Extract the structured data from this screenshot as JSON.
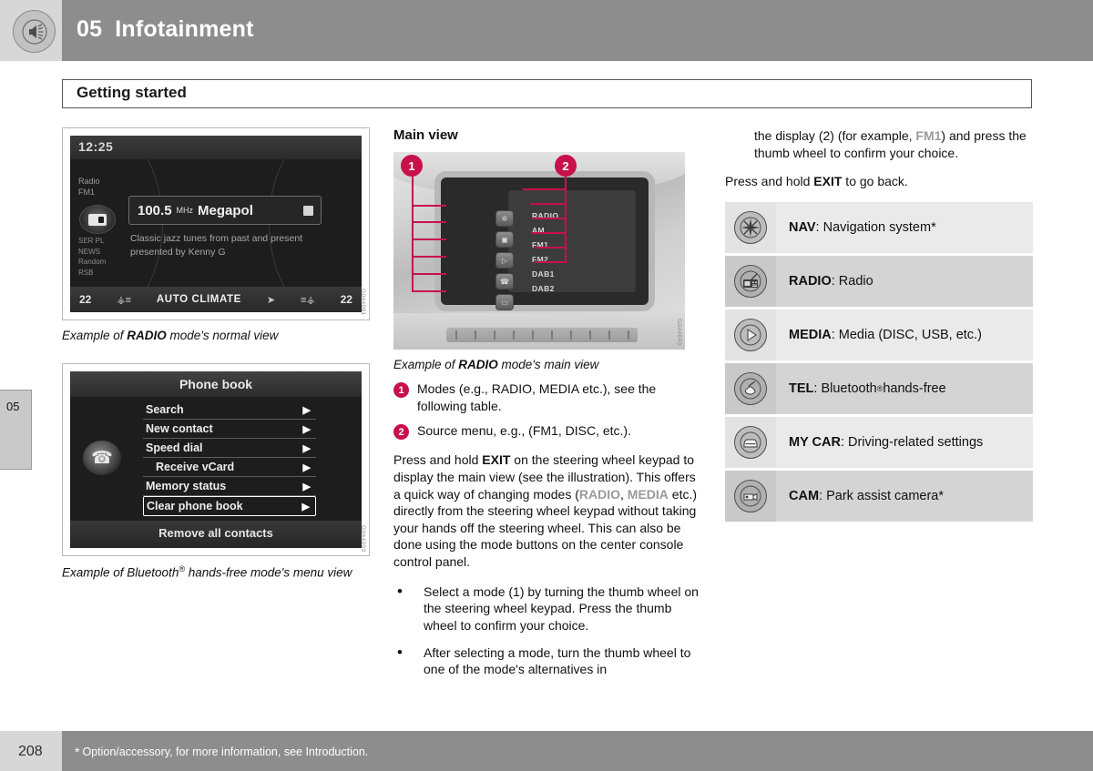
{
  "header": {
    "chapter_number": "05",
    "chapter_title": "Infotainment",
    "icon": "speaker-sound-icon"
  },
  "section": {
    "title": "Getting started"
  },
  "side_tab": {
    "label": "05"
  },
  "footer": {
    "page_number": "208",
    "asterisk": "*",
    "note": "Option/accessory, for more information, see Introduction."
  },
  "figures": {
    "radio_normal": {
      "caption_pre": "Example of ",
      "caption_bold": "RADIO",
      "caption_post": " mode's normal view",
      "image_id": "G044081",
      "display": {
        "clock": "12:25",
        "left_label": "Radio\nFM1",
        "left_menu": "SER PL\nNEWS\nRandom\nRSB",
        "frequency": "100.5",
        "unit": "MHz",
        "station": "Megapol",
        "radiotext": "Classic jazz tunes from past and present presented by Kenny G",
        "climate_left_temp": "22",
        "climate_center": "AUTO CLIMATE",
        "climate_right_temp": "22"
      }
    },
    "phonebook": {
      "caption_pre": "Example of Bluetooth",
      "caption_sup": "®",
      "caption_post": " hands-free mode's menu view",
      "image_id": "G044093",
      "display": {
        "title": "Phone book",
        "items": [
          {
            "label": "Search",
            "indent": false,
            "selected": false
          },
          {
            "label": "New contact",
            "indent": false,
            "selected": false
          },
          {
            "label": "Speed dial",
            "indent": false,
            "selected": false
          },
          {
            "label": "Receive vCard",
            "indent": true,
            "selected": false
          },
          {
            "label": "Memory status",
            "indent": false,
            "selected": false
          },
          {
            "label": "Clear phone book",
            "indent": false,
            "selected": true
          }
        ],
        "footer_item": "Remove all contacts",
        "arrow": "▶"
      }
    },
    "main_view": {
      "heading": "Main view",
      "caption_pre": "Example of ",
      "caption_bold": "RADIO",
      "caption_post": " mode's main view",
      "image_id": "G044043",
      "callouts": [
        "1",
        "2"
      ],
      "source_menu": [
        "RADIO",
        "AM",
        "FM1",
        "FM2",
        "DAB1",
        "DAB2"
      ],
      "mode_buttons": [
        "✧",
        "▣",
        "▷",
        "☎",
        "▭",
        "▤"
      ]
    }
  },
  "main_column": {
    "numbered": [
      {
        "num": "1",
        "text": "Modes (e.g., RADIO, MEDIA etc.), see the following table."
      },
      {
        "num": "2",
        "text": "Source menu, e.g., (FM1, DISC, etc.)."
      }
    ],
    "paragraph_parts": {
      "p1_a": "Press and hold ",
      "p1_b": "EXIT",
      "p1_c": " on the steering wheel keypad to display the main view (see the illustration). This offers a quick way of changing modes (",
      "p1_radio": "RADIO",
      "p1_comma": ", ",
      "p1_media": "MEDIA",
      "p1_d": " etc.) directly from the steering wheel keypad without taking your hands off the steering wheel. This can also be done using the mode buttons on the center console control panel."
    },
    "bullets": [
      "Select a mode (1) by turning the thumb wheel on the steering wheel keypad. Press the thumb wheel to confirm your choice.",
      "After selecting a mode, turn the thumb wheel to one of the mode's alternatives in"
    ]
  },
  "right_column": {
    "continued": {
      "a": "the display (2) (for example, ",
      "b": "FM1",
      "c": ") and press the thumb wheel to confirm your choice."
    },
    "exit_line": {
      "a": "Press and hold ",
      "b": "EXIT",
      "c": " to go back."
    },
    "mode_table": [
      {
        "icon": "navigation-star-icon",
        "name": "NAV",
        "desc": ": Navigation system*"
      },
      {
        "icon": "radio-icon",
        "name": "RADIO",
        "desc": ": Radio"
      },
      {
        "icon": "media-play-icon",
        "name": "MEDIA",
        "desc": ": Media (DISC, USB, etc.)"
      },
      {
        "icon": "telephone-handset-icon",
        "name": "TEL",
        "desc_pre": ": Bluetooth",
        "desc_sup": "®",
        "desc_post": " hands-free"
      },
      {
        "icon": "car-front-icon",
        "name": "MY CAR",
        "desc": ": Driving-related settings"
      },
      {
        "icon": "park-camera-icon",
        "name": "CAM",
        "desc": ": Park assist camera*"
      }
    ]
  },
  "colors": {
    "accent_crimson": "#c8104a",
    "header_band": "#8d8d8d",
    "header_left": "#d7d7d7",
    "grey_keyword": "#9a9a9a"
  }
}
